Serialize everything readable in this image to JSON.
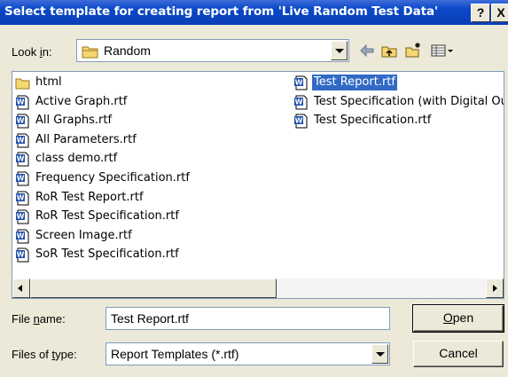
{
  "dialog": {
    "title": "Select template for creating report from 'Live Random Test Data'",
    "help_label": "?",
    "close_label": "X"
  },
  "lookin": {
    "label_pre": "Look ",
    "label_accel": "i",
    "label_post": "n:",
    "value": "Random"
  },
  "toolbar": {
    "back_icon": "back-arrow-icon",
    "up_icon": "up-folder-icon",
    "new_folder_icon": "new-folder-icon",
    "views_icon": "views-menu-icon"
  },
  "files": {
    "column1": [
      {
        "name": "html",
        "type": "folder"
      },
      {
        "name": "Active Graph.rtf",
        "type": "doc"
      },
      {
        "name": "All Graphs.rtf",
        "type": "doc"
      },
      {
        "name": "All Parameters.rtf",
        "type": "doc"
      },
      {
        "name": "class demo.rtf",
        "type": "doc"
      },
      {
        "name": "Frequency Specification.rtf",
        "type": "doc"
      },
      {
        "name": "RoR Test Report.rtf",
        "type": "doc"
      },
      {
        "name": "RoR Test Specification.rtf",
        "type": "doc"
      },
      {
        "name": "Screen Image.rtf",
        "type": "doc"
      },
      {
        "name": "SoR Test Specification.rtf",
        "type": "doc"
      }
    ],
    "column2": [
      {
        "name": "Test Report.rtf",
        "type": "doc",
        "selected": true
      },
      {
        "name": "Test Specification (with Digital Outp",
        "type": "doc"
      },
      {
        "name": "Test Specification.rtf",
        "type": "doc"
      }
    ]
  },
  "filename": {
    "label_pre": "File ",
    "label_accel": "n",
    "label_post": "ame:",
    "value": "Test Report.rtf"
  },
  "filetype": {
    "label_pre": "Files of ",
    "label_accel": "t",
    "label_post": "ype:",
    "value": "Report Templates (*.rtf)"
  },
  "buttons": {
    "open_accel": "O",
    "open_rest": "pen",
    "cancel": "Cancel"
  },
  "colors": {
    "title_bar": "#0a49c9",
    "selection": "#316ac5",
    "dialog_bg": "#ece9d8"
  }
}
